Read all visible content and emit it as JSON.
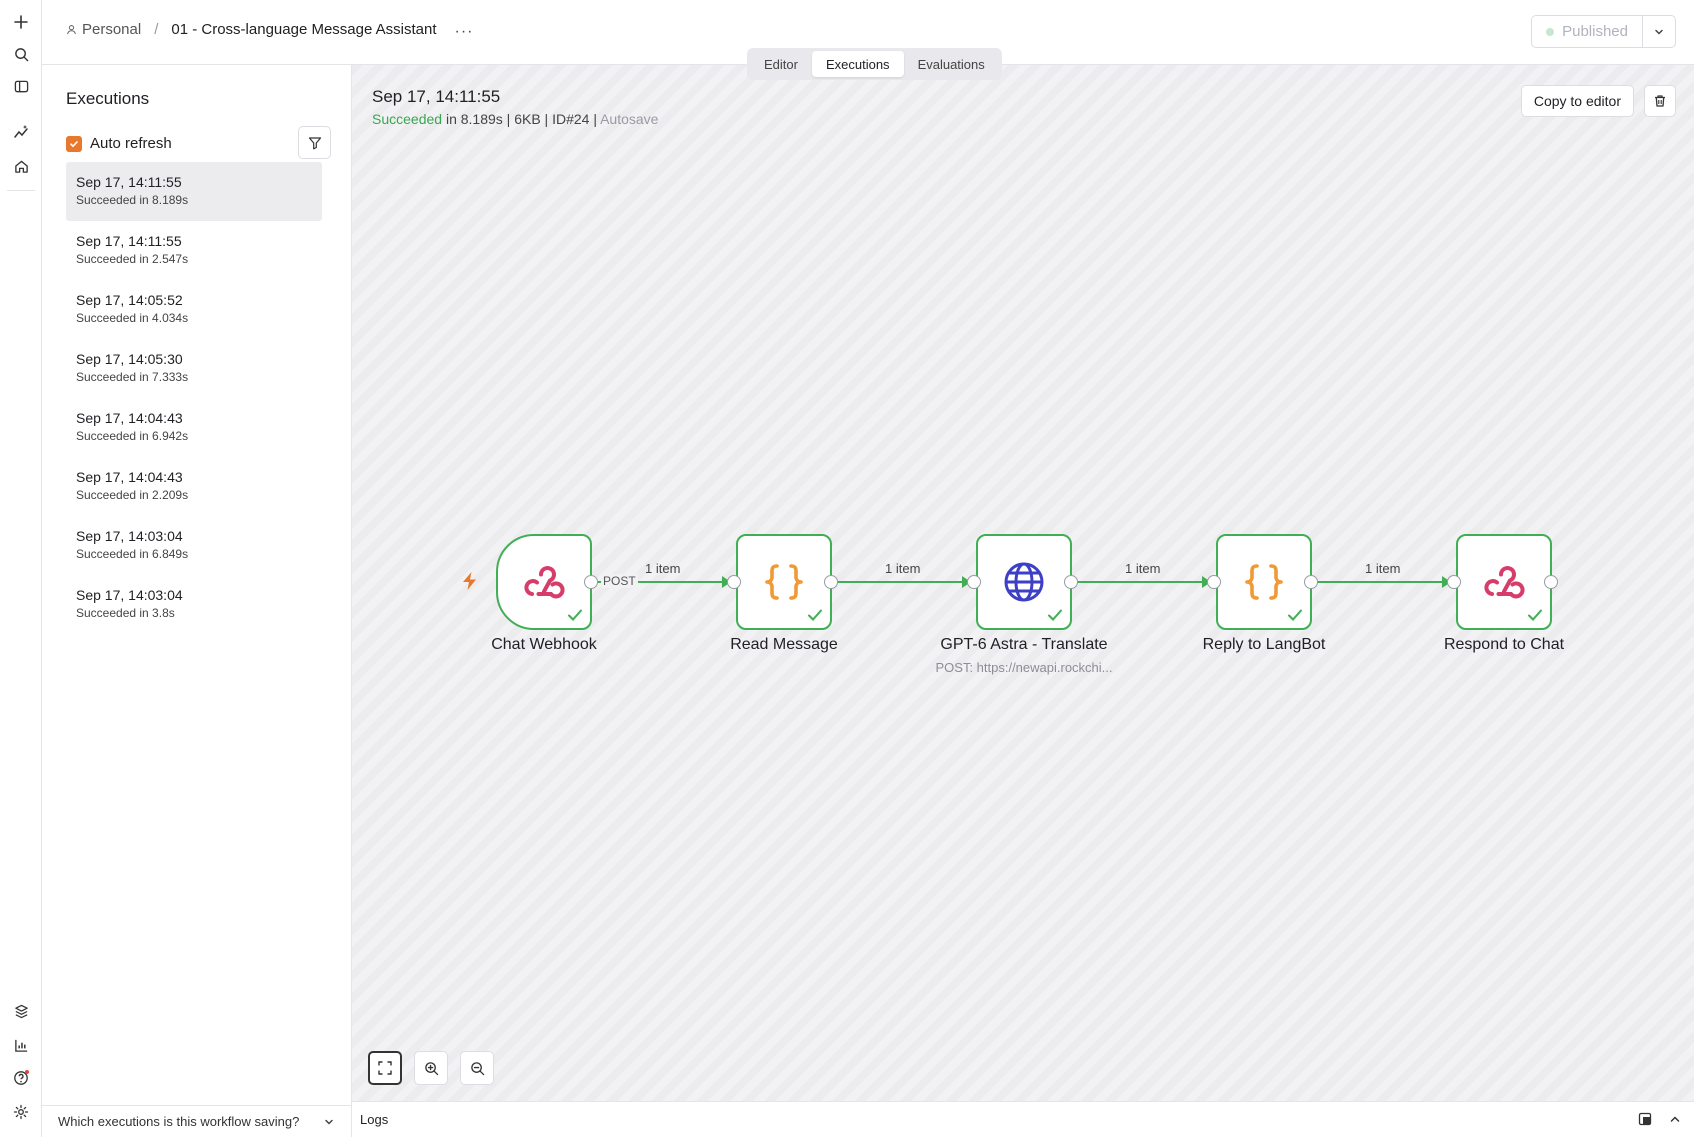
{
  "header": {
    "workspace": "Personal",
    "workflow_title": "01 - Cross-language Message Assistant",
    "more_label": "···",
    "publish_label": "Published"
  },
  "tabs": [
    {
      "label": "Editor",
      "active": false
    },
    {
      "label": "Executions",
      "active": true
    },
    {
      "label": "Evaluations",
      "active": false
    }
  ],
  "sidebar": {
    "title": "Executions",
    "auto_refresh_label": "Auto refresh",
    "auto_refresh_checked": true,
    "executions": [
      {
        "date": "Sep 17, 14:11:55",
        "status": "Succeeded in 8.189s",
        "selected": true
      },
      {
        "date": "Sep 17, 14:11:55",
        "status": "Succeeded in 2.547s"
      },
      {
        "date": "Sep 17, 14:05:52",
        "status": "Succeeded in 4.034s"
      },
      {
        "date": "Sep 17, 14:05:30",
        "status": "Succeeded in 7.333s"
      },
      {
        "date": "Sep 17, 14:04:43",
        "status": "Succeeded in 6.942s"
      },
      {
        "date": "Sep 17, 14:04:43",
        "status": "Succeeded in 2.209s"
      },
      {
        "date": "Sep 17, 14:03:04",
        "status": "Succeeded in 6.849s"
      },
      {
        "date": "Sep 17, 14:03:04",
        "status": "Succeeded in 3.8s"
      }
    ],
    "saving_question": "Which executions is this workflow saving?"
  },
  "execution": {
    "date": "Sep 17, 14:11:55",
    "status": "Succeeded",
    "duration": " in 8.189s | 6KB | ID#24 | ",
    "mode": "Autosave",
    "copy_label": "Copy to editor"
  },
  "workflow": {
    "nodes": [
      {
        "name": "Chat Webhook",
        "icon": "webhook-icon",
        "subtitle": ""
      },
      {
        "name": "Read Message",
        "icon": "code-braces-icon",
        "subtitle": ""
      },
      {
        "name": "GPT-6 Astra - Translate",
        "icon": "globe-icon",
        "subtitle": "POST: https://newapi.rockchi..."
      },
      {
        "name": "Reply to LangBot",
        "icon": "code-braces-icon",
        "subtitle": ""
      },
      {
        "name": "Respond to Chat",
        "icon": "webhook-icon",
        "subtitle": ""
      }
    ],
    "connections": [
      {
        "label": "1 item",
        "output_label": "POST"
      },
      {
        "label": "1 item"
      },
      {
        "label": "1 item"
      },
      {
        "label": "1 item"
      }
    ]
  },
  "logs": {
    "label": "Logs"
  },
  "colors": {
    "success": "#3fae55",
    "accent": "#e8782b",
    "webhook": "#d63d6a",
    "code": "#f09a35",
    "globe": "#3d3fc6"
  }
}
